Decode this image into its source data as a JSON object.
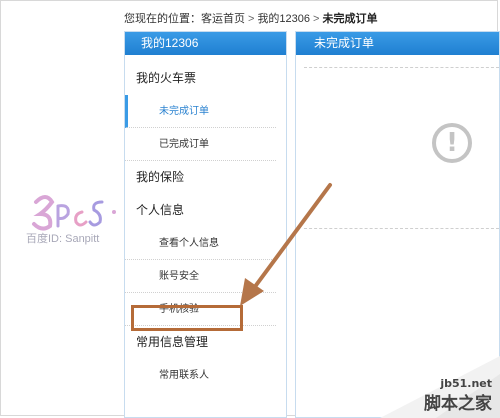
{
  "breadcrumb": {
    "prefix": "您现在的位置：",
    "home": "客运首页",
    "sep": ">",
    "mine": "我的12306",
    "current": "未完成订单"
  },
  "sidebar": {
    "title": "我的12306",
    "groups": [
      {
        "label": "我的火车票",
        "items": [
          "未完成订单",
          "已完成订单"
        ]
      },
      {
        "label": "我的保险",
        "items": []
      },
      {
        "label": "个人信息",
        "items": [
          "查看个人信息",
          "账号安全",
          "手机核验"
        ]
      },
      {
        "label": "常用信息管理",
        "items": [
          "常用联系人"
        ]
      }
    ],
    "active_item": "未完成订单",
    "highlighted_item": "手机核验"
  },
  "main": {
    "title": "未完成订单",
    "icon": "exclamation-circle-icon"
  },
  "watermark": {
    "text": "百度ID: Sanpitt"
  },
  "corner": {
    "url": "jb51.net",
    "name": "脚本之家"
  },
  "colors": {
    "header_blue": "#1f7fd1",
    "active_blue": "#2a82d0",
    "annotation_brown": "#b56b38"
  }
}
